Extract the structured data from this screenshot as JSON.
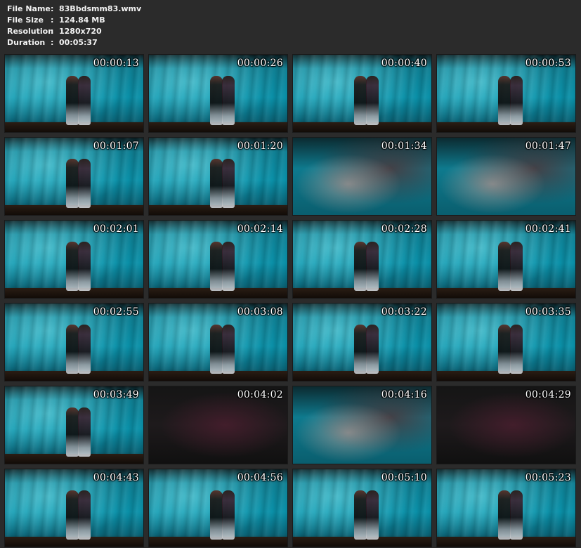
{
  "info": {
    "file_name_label": "File Name",
    "file_name": "83Bbdsmm83.wmv",
    "file_size_label": "File Size",
    "file_size": "124.84 MB",
    "resolution_label": "Resolution",
    "resolution": "1280x720",
    "duration_label": "Duration",
    "duration": "00:05:37",
    "separator": ":"
  },
  "thumbnails": [
    {
      "timestamp": "00:00:13",
      "scene": "wide"
    },
    {
      "timestamp": "00:00:26",
      "scene": "wide"
    },
    {
      "timestamp": "00:00:40",
      "scene": "wide"
    },
    {
      "timestamp": "00:00:53",
      "scene": "wide"
    },
    {
      "timestamp": "00:01:07",
      "scene": "wide"
    },
    {
      "timestamp": "00:01:20",
      "scene": "wide"
    },
    {
      "timestamp": "00:01:34",
      "scene": "closeup"
    },
    {
      "timestamp": "00:01:47",
      "scene": "closeup"
    },
    {
      "timestamp": "00:02:01",
      "scene": "wide"
    },
    {
      "timestamp": "00:02:14",
      "scene": "wide"
    },
    {
      "timestamp": "00:02:28",
      "scene": "wide"
    },
    {
      "timestamp": "00:02:41",
      "scene": "wide"
    },
    {
      "timestamp": "00:02:55",
      "scene": "wide"
    },
    {
      "timestamp": "00:03:08",
      "scene": "wide"
    },
    {
      "timestamp": "00:03:22",
      "scene": "wide"
    },
    {
      "timestamp": "00:03:35",
      "scene": "wide"
    },
    {
      "timestamp": "00:03:49",
      "scene": "wide"
    },
    {
      "timestamp": "00:04:02",
      "scene": "dark"
    },
    {
      "timestamp": "00:04:16",
      "scene": "closeup"
    },
    {
      "timestamp": "00:04:29",
      "scene": "dark"
    },
    {
      "timestamp": "00:04:43",
      "scene": "wide"
    },
    {
      "timestamp": "00:04:56",
      "scene": "wide"
    },
    {
      "timestamp": "00:05:10",
      "scene": "wide"
    },
    {
      "timestamp": "00:05:23",
      "scene": "wide"
    }
  ]
}
